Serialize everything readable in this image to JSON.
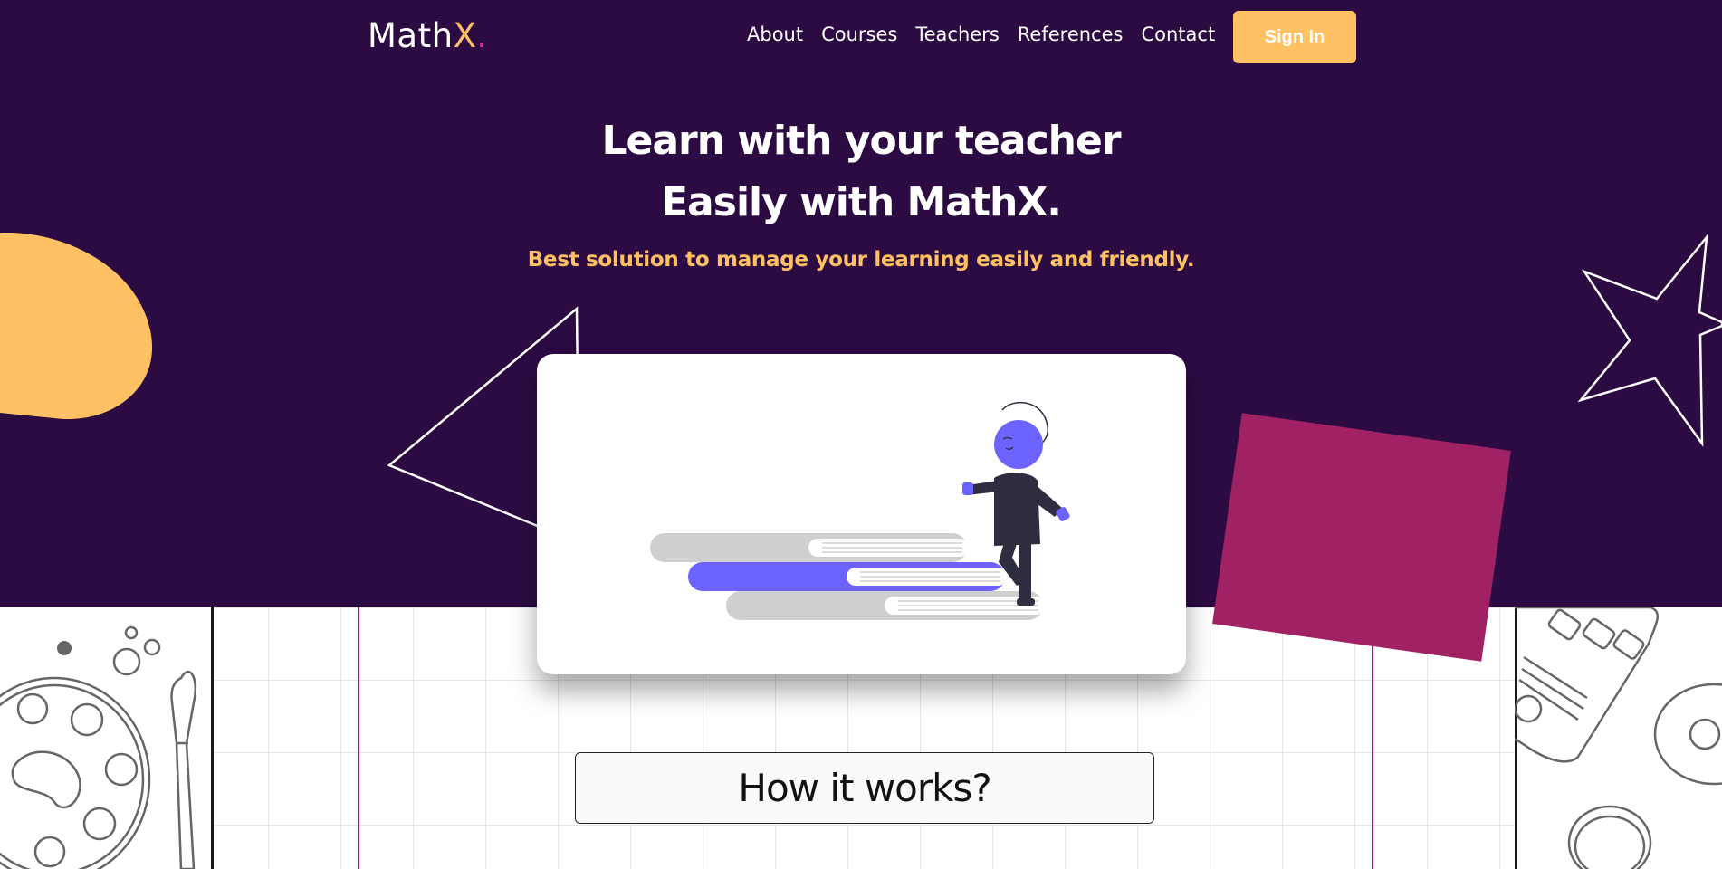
{
  "brand": {
    "name_main": "Math",
    "name_accent": "X",
    "name_dot": "."
  },
  "nav": {
    "items": [
      "About",
      "Courses",
      "Teachers",
      "References",
      "Contact"
    ],
    "sign_in": "Sign In"
  },
  "hero": {
    "headline_line1": "Learn with your teacher",
    "headline_line2": "Easily with MathX.",
    "tagline": "Best solution to manage your learning easily and friendly."
  },
  "section": {
    "how_it_works": "How it works?"
  },
  "colors": {
    "hero_bg": "#2c0b43",
    "accent_yellow": "#ffc163",
    "accent_magenta": "#a02264",
    "accent_purple": "#6c63ff"
  },
  "icons": [
    "star-outline-icon",
    "triangle-outline-icon",
    "palette-sketch-icon",
    "bus-sketch-icon",
    "person-on-books-illustration"
  ]
}
